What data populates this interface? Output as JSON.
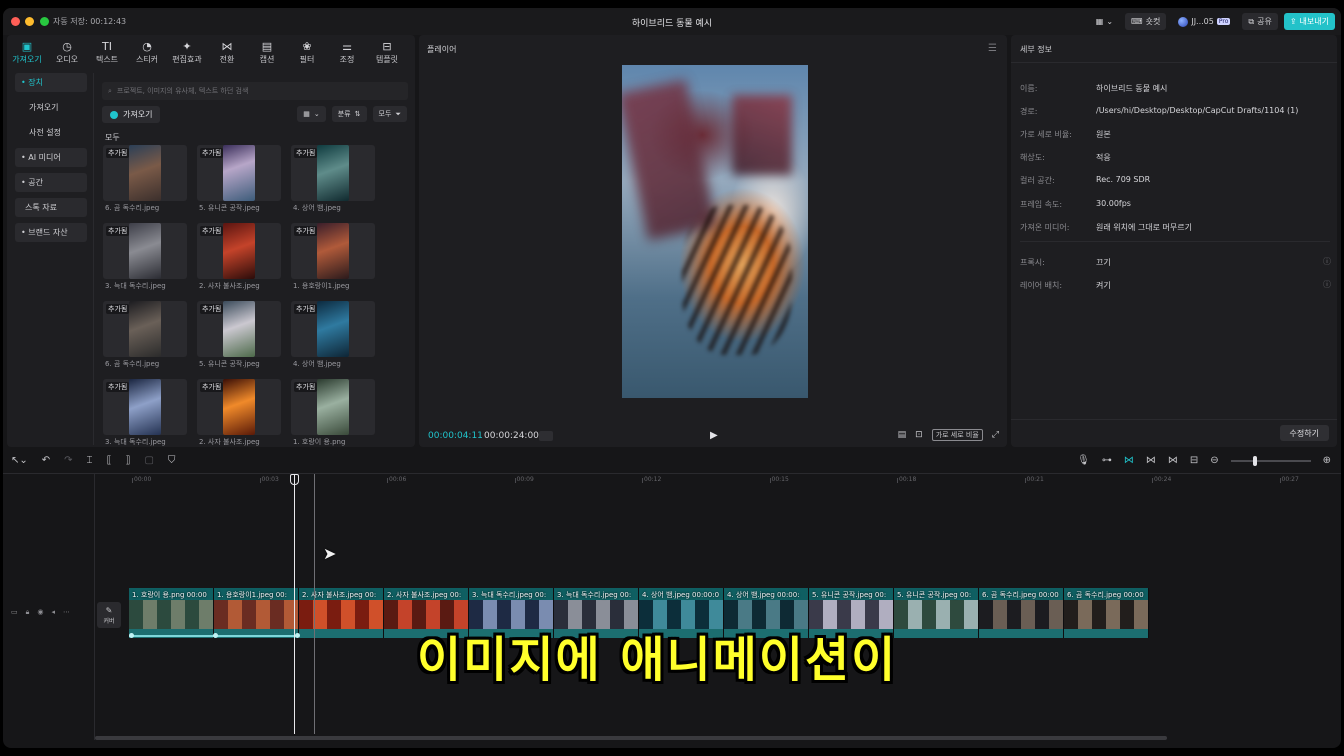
{
  "titlebar": {
    "autosave": "자동 저장: 00:12:43",
    "title": "하이브리드 동물 예시",
    "shortcut_label": "숏컷",
    "user_name": "JJ...05",
    "pro_badge": "Pro",
    "share_label": "공유",
    "export_label": "내보내기"
  },
  "toolbar": {
    "items": [
      {
        "label": "가져오기",
        "icon": "import-icon",
        "glyph": "▣"
      },
      {
        "label": "오디오",
        "icon": "audio-icon",
        "glyph": "◷"
      },
      {
        "label": "텍스트",
        "icon": "text-icon",
        "glyph": "TI"
      },
      {
        "label": "스티커",
        "icon": "sticker-icon",
        "glyph": "◔"
      },
      {
        "label": "편집효과",
        "icon": "effects-icon",
        "glyph": "✦"
      },
      {
        "label": "전환",
        "icon": "transition-icon",
        "glyph": "⋈"
      },
      {
        "label": "캡션",
        "icon": "caption-icon",
        "glyph": "▤"
      },
      {
        "label": "필터",
        "icon": "filter-icon",
        "glyph": "❀"
      },
      {
        "label": "조정",
        "icon": "adjust-icon",
        "glyph": "⚌"
      },
      {
        "label": "템플릿",
        "icon": "template-icon",
        "glyph": "⊟"
      }
    ]
  },
  "side_nav": {
    "device": "• 장치",
    "import": "가져오기",
    "presets": "사전 설정",
    "ai_media": "• AI 미디어",
    "space": "• 공간",
    "stock": "스톡 자료",
    "brand": "• 브랜드 자산"
  },
  "media": {
    "search_placeholder": "프로젝트, 이미지의 유사체, 텍스트 하던 검색",
    "import_button": "가져오기",
    "sort_label": "분류",
    "all_filter": "모두",
    "all_heading": "모두",
    "added_badge": "추가됨",
    "items": [
      {
        "name": "6. 곰 독수리.jpeg"
      },
      {
        "name": "5. 유니콘 공작.jpeg"
      },
      {
        "name": "4. 상어 뱀.jpeg"
      },
      {
        "name": "3. 늑대 독수리.jpeg"
      },
      {
        "name": "2. 사자 불사조.jpeg"
      },
      {
        "name": "1. 용호랑이1.jpeg"
      },
      {
        "name": "6. 곰 독수리.jpeg"
      },
      {
        "name": "5. 유니콘 공작.jpeg"
      },
      {
        "name": "4. 상어 뱀.jpeg"
      },
      {
        "name": "3. 늑대 독수리.jpeg"
      },
      {
        "name": "2. 사자 불사조.jpeg"
      },
      {
        "name": "1. 호랑이 용.png"
      }
    ]
  },
  "player": {
    "title": "플레이어",
    "current_time": "00:00:04:11",
    "total_time": "00:00:24:00",
    "ratio_label": "가로 세로 비율"
  },
  "details": {
    "title": "세부 정보",
    "rows": [
      {
        "k": "이름:",
        "v": "하이브리드 동물 예시"
      },
      {
        "k": "경로:",
        "v": "/Users/hi/Desktop/Desktop/CapCut Drafts/1104 (1)"
      },
      {
        "k": "가로 세로 비율:",
        "v": "원본"
      },
      {
        "k": "해상도:",
        "v": "적응"
      },
      {
        "k": "컬러 공간:",
        "v": "Rec. 709 SDR"
      },
      {
        "k": "프레임 속도:",
        "v": "30.00fps"
      },
      {
        "k": "가져온 미디어:",
        "v": "원래 위치에 그대로 머무르기"
      }
    ],
    "proxy_k": "프록시:",
    "proxy_v": "끄기",
    "layer_k": "레이어 배치:",
    "layer_v": "켜기",
    "edit_button": "수정하기"
  },
  "timeline": {
    "ticks": [
      "00:00",
      "00:03",
      "00:06",
      "00:09",
      "00:12",
      "00:15",
      "00:18",
      "00:21",
      "00:24",
      "00:27"
    ],
    "cover_label": "커버",
    "clips": [
      {
        "label": "1. 호랑이 용.png  00:00"
      },
      {
        "label": "1. 용호랑이1.jpeg  00:"
      },
      {
        "label": "2. 사자 불사조.jpeg  00:"
      },
      {
        "label": "2. 사자 불사조.jpeg  00:"
      },
      {
        "label": "3. 늑대 독수리.jpeg  00:"
      },
      {
        "label": "3. 늑대 독수리.jpeg  00:"
      },
      {
        "label": "4. 상어 뱀.jpeg  00:00:0"
      },
      {
        "label": "4. 상어 뱀.jpeg  00:00:"
      },
      {
        "label": "5. 유니콘 공작.jpeg  00:"
      },
      {
        "label": "5. 유니콘 공작.jpeg  00:"
      },
      {
        "label": "6. 곰 독수리.jpeg  00:00"
      },
      {
        "label": "6. 곰 독수리.jpeg  00:00"
      }
    ]
  },
  "subtitle": "이미지에 애니메이션이",
  "colors": {
    "accent": "#20c4cc",
    "subtitle": "#ffff2b",
    "clip": "#0f5f62"
  }
}
